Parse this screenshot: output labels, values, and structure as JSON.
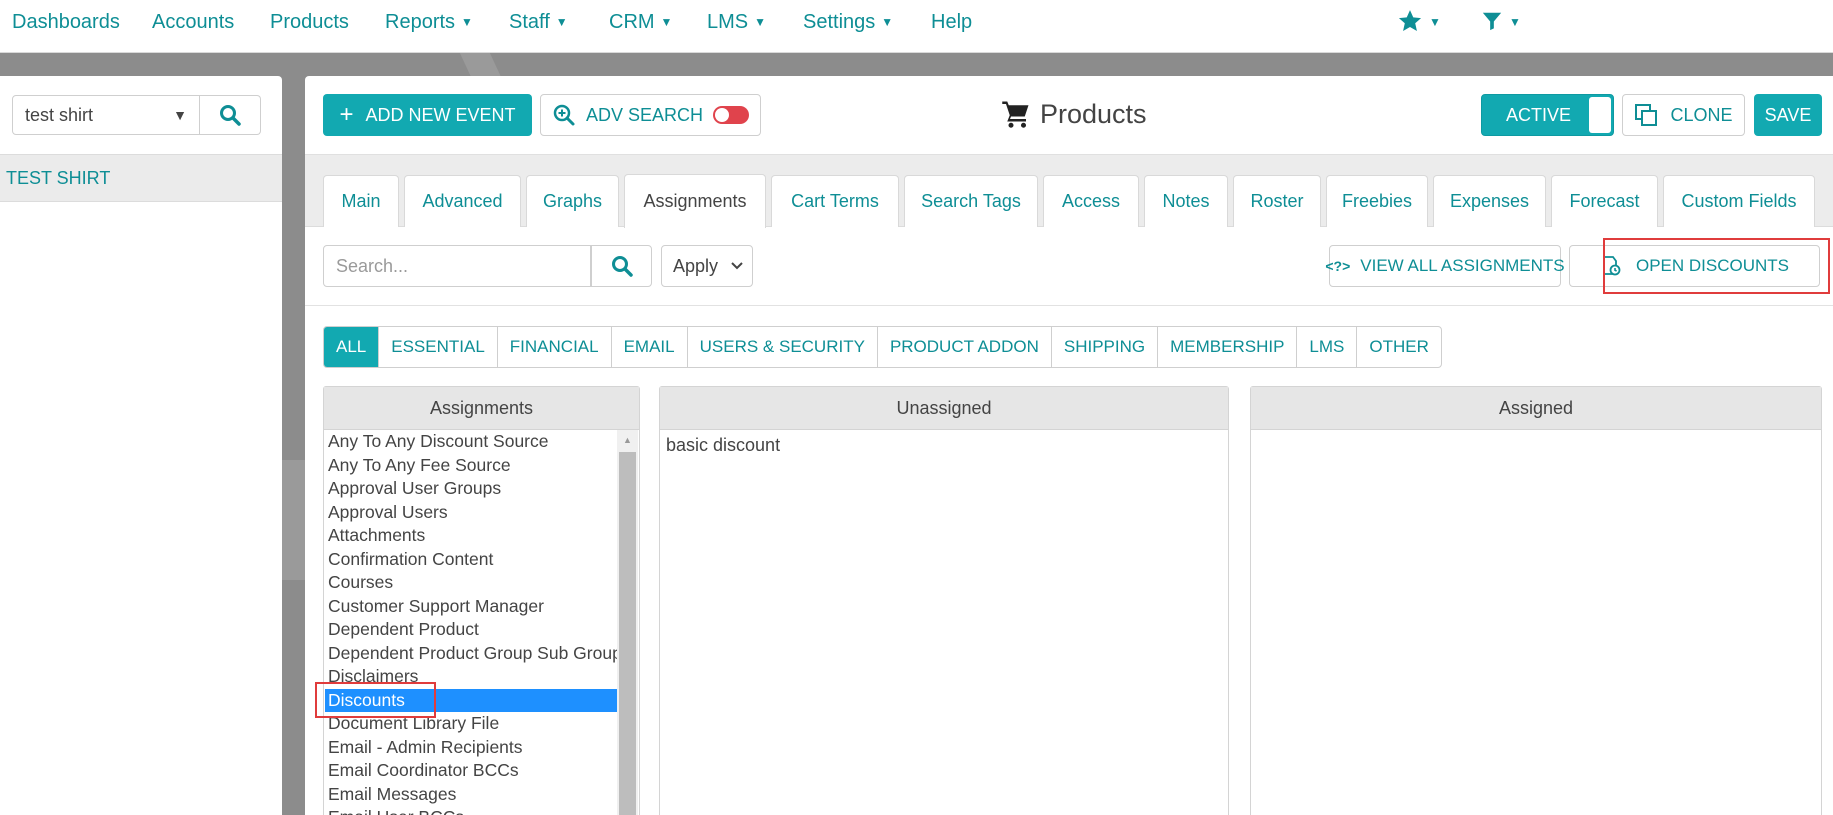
{
  "nav": {
    "items": [
      {
        "label": "Dashboards",
        "has_caret": false
      },
      {
        "label": "Accounts",
        "has_caret": false
      },
      {
        "label": "Products",
        "has_caret": false
      },
      {
        "label": "Reports",
        "has_caret": true
      },
      {
        "label": "Staff",
        "has_caret": true
      },
      {
        "label": "CRM",
        "has_caret": true
      },
      {
        "label": "LMS",
        "has_caret": true
      },
      {
        "label": "Settings",
        "has_caret": true
      },
      {
        "label": "Help",
        "has_caret": false
      }
    ],
    "right_icons": [
      "star-icon",
      "filter-icon"
    ]
  },
  "sidebar": {
    "search_value": "test shirt",
    "items": [
      {
        "label": "TEST SHIRT"
      }
    ]
  },
  "toolbar": {
    "add_event_label": "ADD NEW EVENT",
    "adv_search_label": "ADV SEARCH",
    "adv_search_enabled": false,
    "page_title": "Products",
    "active_label": "ACTIVE",
    "clone_label": "CLONE",
    "save_label": "SAVE"
  },
  "tabs": [
    {
      "label": "Main"
    },
    {
      "label": "Advanced"
    },
    {
      "label": "Graphs"
    },
    {
      "label": "Assignments",
      "active": true
    },
    {
      "label": "Cart Terms"
    },
    {
      "label": "Search Tags"
    },
    {
      "label": "Access"
    },
    {
      "label": "Notes"
    },
    {
      "label": "Roster"
    },
    {
      "label": "Freebies"
    },
    {
      "label": "Expenses"
    },
    {
      "label": "Forecast"
    },
    {
      "label": "Custom Fields"
    }
  ],
  "assign_toolbar": {
    "search_placeholder": "Search...",
    "apply_label": "Apply",
    "view_all_icon_text": "<?>",
    "view_all_label": "VIEW ALL ASSIGNMENTS",
    "open_discounts_label": "OPEN DISCOUNTS"
  },
  "filters": [
    {
      "label": "ALL",
      "active": true
    },
    {
      "label": "ESSENTIAL"
    },
    {
      "label": "FINANCIAL"
    },
    {
      "label": "EMAIL"
    },
    {
      "label": "USERS & SECURITY"
    },
    {
      "label": "PRODUCT ADDON"
    },
    {
      "label": "SHIPPING"
    },
    {
      "label": "MEMBERSHIP"
    },
    {
      "label": "LMS"
    },
    {
      "label": "OTHER"
    }
  ],
  "assignments_box": {
    "header": "Assignments",
    "items": [
      "Any To Any Discount Source",
      "Any To Any Fee Source",
      "Approval User Groups",
      "Approval Users",
      "Attachments",
      "Confirmation Content",
      "Courses",
      "Customer Support Manager",
      "Dependent Product",
      "Dependent Product Group Sub Group",
      "Disclaimers",
      "Discounts",
      "Document Library File",
      "Email - Admin Recipients",
      "Email Coordinator BCCs",
      "Email Messages",
      "Email User BCCs"
    ],
    "selected": "Discounts"
  },
  "unassigned_box": {
    "header": "Unassigned",
    "items": [
      "basic discount"
    ]
  },
  "assigned_box": {
    "header": "Assigned",
    "items": []
  },
  "colors": {
    "accent": "#12a9b1",
    "link": "#0e8e95",
    "selection": "#1e90ff",
    "highlight_box": "#e03c3c",
    "toggle_off": "#e0434c"
  }
}
